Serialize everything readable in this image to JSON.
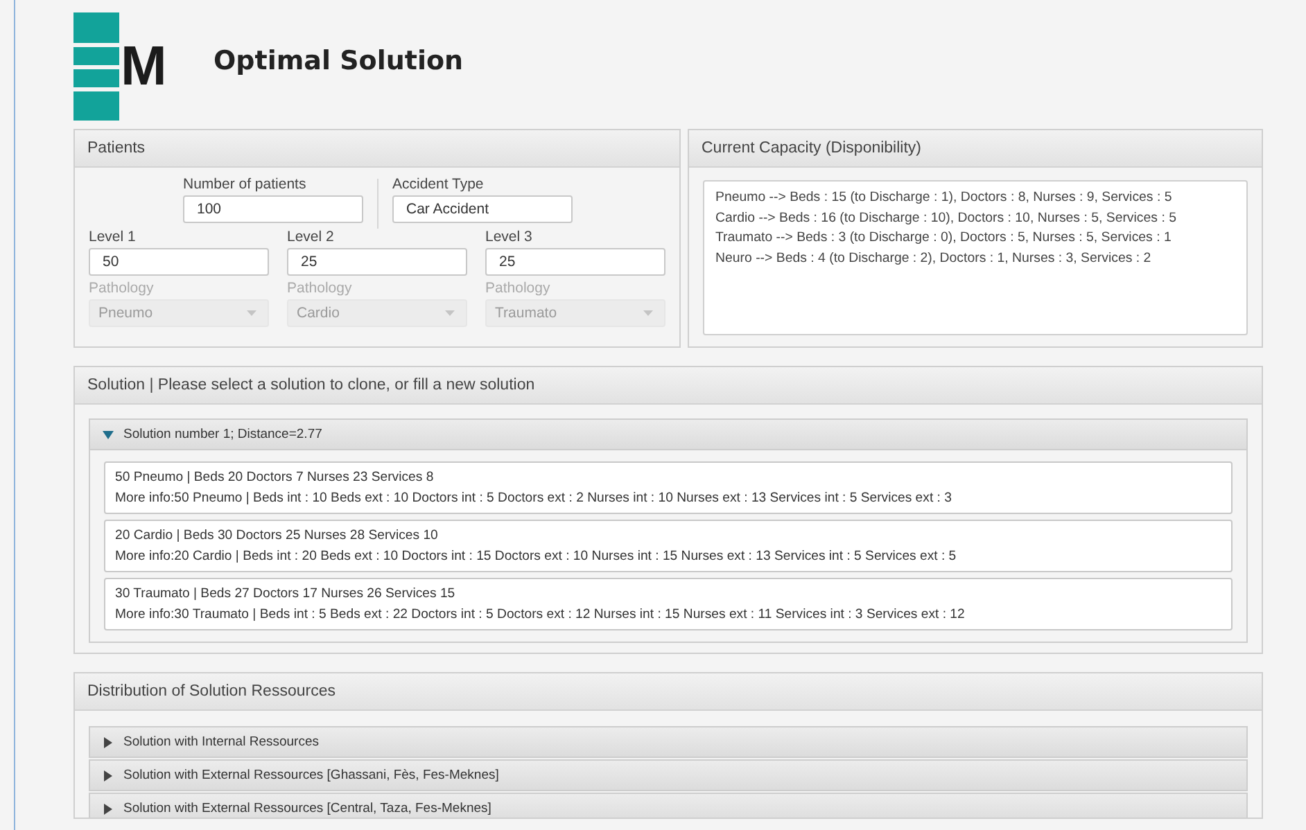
{
  "app": {
    "logo": "M",
    "title": "Optimal Solution"
  },
  "patients": {
    "title": "Patients",
    "top_fields": [
      {
        "label": "Number of patients",
        "value": "100"
      },
      {
        "label": "Accident Type",
        "value": "Car Accident"
      }
    ],
    "levels": [
      {
        "label": "Level 1",
        "value": "50",
        "pathology_label": "Pathology",
        "pathology": "Pneumo",
        "disabled": true
      },
      {
        "label": "Level 2",
        "value": "25",
        "pathology_label": "Pathology",
        "pathology": "Cardio",
        "disabled": true
      },
      {
        "label": "Level 3",
        "value": "25",
        "pathology_label": "Pathology",
        "pathology": "Traumato",
        "disabled": true
      }
    ]
  },
  "capacity": {
    "title": "Current Capacity (Disponibility)",
    "lines": [
      "Pneumo --> Beds : 15 (to Discharge : 1), Doctors : 8, Nurses : 9, Services : 5",
      "Cardio --> Beds : 16 (to Discharge : 10), Doctors : 10, Nurses : 5, Services : 5",
      "Traumato --> Beds : 3 (to Discharge : 0), Doctors : 5, Nurses : 5, Services : 1",
      "Neuro --> Beds : 4 (to Discharge : 2), Doctors : 1, Nurses : 3, Services : 2"
    ]
  },
  "solution": {
    "title": "Solution | Please select a solution to clone, or fill a new solution",
    "panes": [
      {
        "title": "Solution number 1; Distance=2.77",
        "expanded": true,
        "items": [
          {
            "summary": "50 Pneumo | Beds 20 Doctors 7 Nurses 23 Services 8",
            "details": "More info:50 Pneumo | Beds int : 10 Beds ext : 10 Doctors int : 5 Doctors ext : 2 Nurses int : 10 Nurses ext : 13 Services int : 5 Services ext : 3"
          },
          {
            "summary": "20 Cardio | Beds 30 Doctors 25 Nurses 28 Services 10",
            "details": "More info:20 Cardio | Beds int : 20 Beds ext : 10 Doctors int : 15 Doctors ext : 10 Nurses int : 15 Nurses ext : 13 Services int : 5 Services ext : 5"
          },
          {
            "summary": "30 Traumato | Beds 27 Doctors 17 Nurses 26 Services 15",
            "details": "More info:30 Traumato | Beds int : 5 Beds ext : 22 Doctors int : 5 Doctors ext : 12 Nurses int : 15 Nurses ext : 11 Services int : 3 Services ext : 12"
          }
        ]
      }
    ]
  },
  "distribution": {
    "title": "Distribution of Solution Ressources",
    "panes": [
      {
        "title": "Solution with Internal Ressources",
        "expanded": false
      },
      {
        "title": "Solution with External Ressources [Ghassani, Fès, Fes-Meknes]",
        "expanded": false
      },
      {
        "title": "Solution with External Ressources [Central, Taza, Fes-Meknes]",
        "expanded": false
      }
    ]
  }
}
